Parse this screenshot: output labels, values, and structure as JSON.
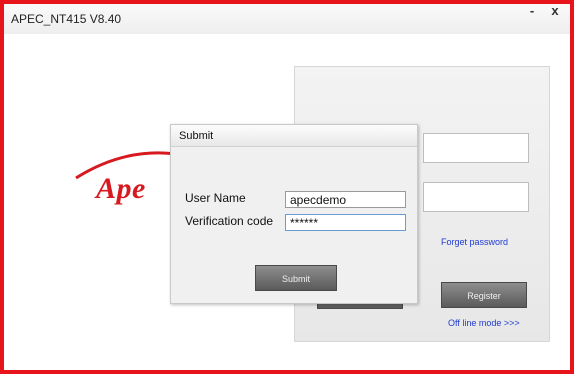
{
  "window": {
    "title": "APEC_NT415  V8.40",
    "minimize_symbol": "-",
    "close_symbol": "x"
  },
  "background": {
    "logo_text": "Ape",
    "forget_password_link": "Forget password",
    "register_button": "Register",
    "offline_mode_link": "Off line mode >>>"
  },
  "dialog": {
    "title": "Submit",
    "username_label": "User Name",
    "username_value": "apecdemo",
    "verification_label": "Verification code",
    "verification_value": "******",
    "submit_button": "Submit"
  },
  "colors": {
    "frame_border": "#e8141b",
    "brand_red": "#d71920",
    "link_blue": "#1f3ad1"
  }
}
